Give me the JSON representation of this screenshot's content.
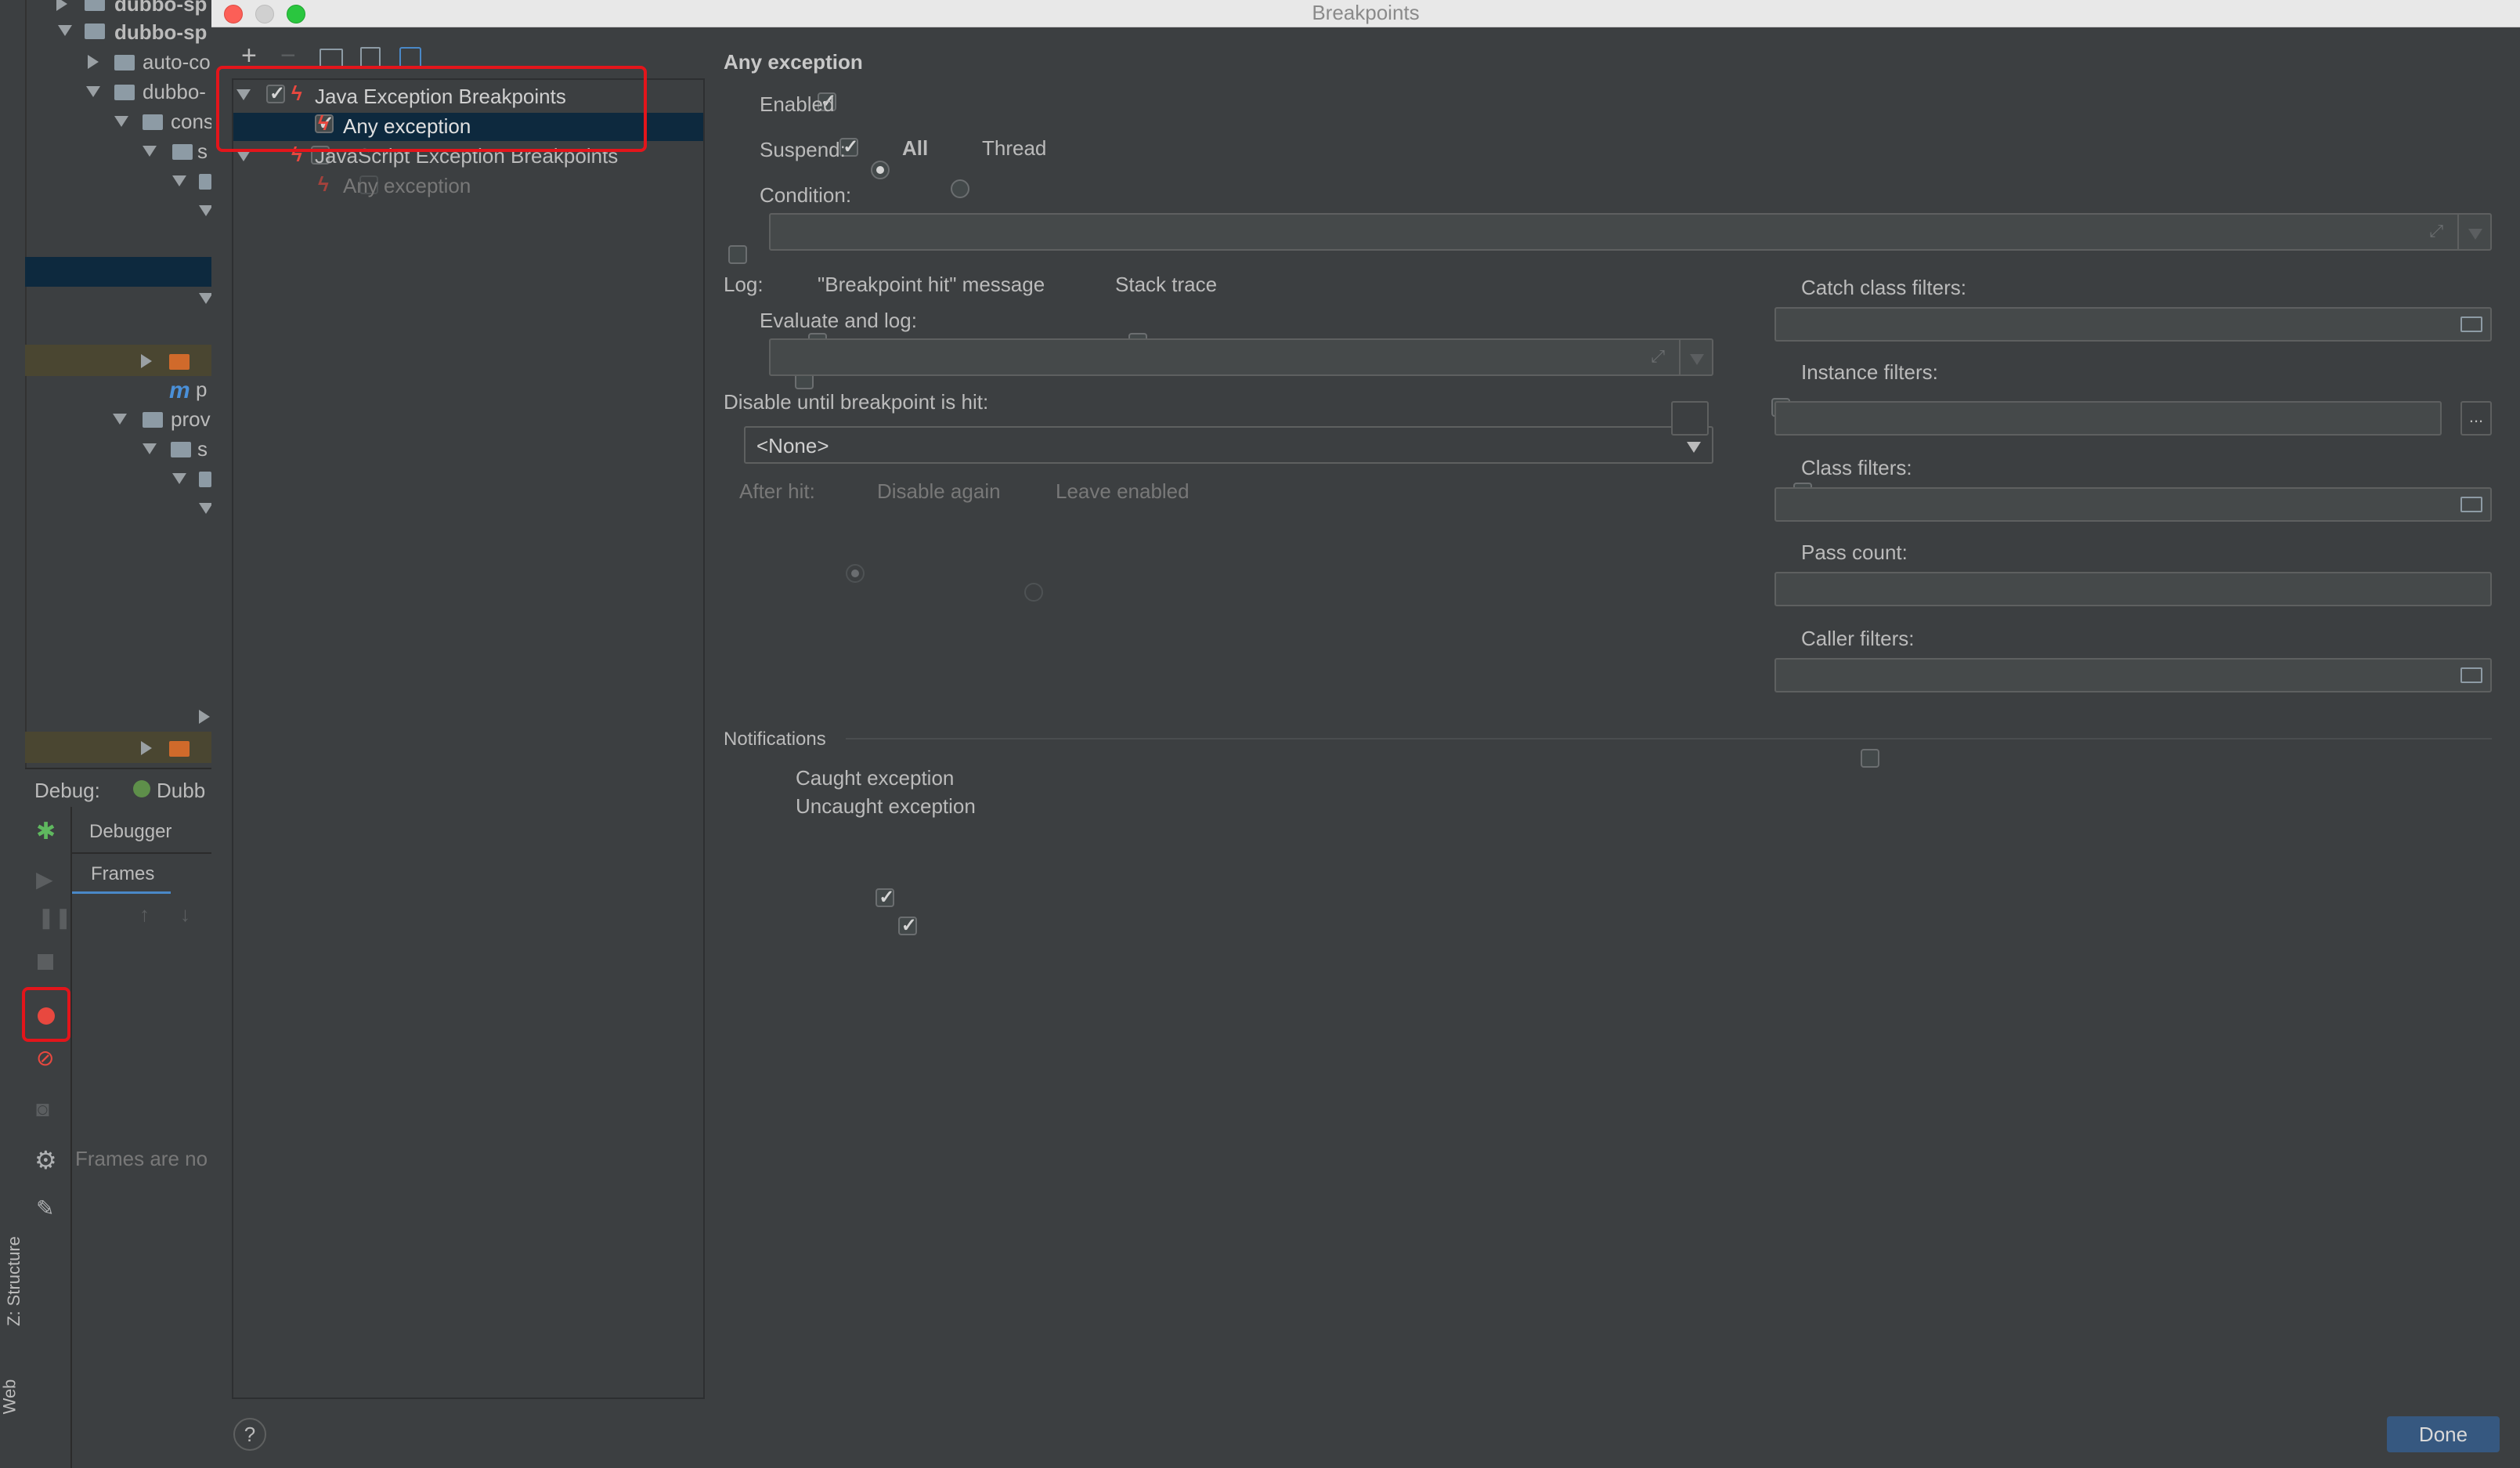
{
  "dialog": {
    "title": "Breakpoints",
    "done_label": "Done",
    "help_label": "?"
  },
  "tree": {
    "groups": [
      {
        "label": "Java Exception Breakpoints",
        "checked": true,
        "children": [
          {
            "label": "Any exception",
            "checked": true,
            "selected": true
          }
        ]
      },
      {
        "label": "JavaScript Exception Breakpoints",
        "checked": false,
        "children": [
          {
            "label": "Any exception",
            "checked": false
          }
        ]
      }
    ]
  },
  "details": {
    "heading": "Any exception",
    "enabled_label": "Enabled",
    "suspend_label": "Suspend:",
    "suspend_all_label": "All",
    "suspend_thread_label": "Thread",
    "condition_label": "Condition:",
    "log_label": "Log:",
    "log_message_label": "\"Breakpoint hit\" message",
    "log_stack_label": "Stack trace",
    "evaluate_label": "Evaluate and log:",
    "disable_until_label": "Disable until breakpoint is hit:",
    "disable_until_value": "<None>",
    "after_hit_label": "After hit:",
    "disable_again_label": "Disable again",
    "leave_enabled_label": "Leave enabled",
    "catch_filters_label": "Catch class filters:",
    "instance_filters_label": "Instance filters:",
    "instance_filters_btn": "...",
    "class_filters_label": "Class filters:",
    "pass_count_label": "Pass count:",
    "caller_filters_label": "Caller filters:",
    "notifications_label": "Notifications",
    "caught_label": "Caught exception",
    "uncaught_label": "Uncaught exception"
  },
  "ide": {
    "project_items": [
      "dubbo-sp",
      "dubbo-sp",
      "auto-co",
      "dubbo-",
      "cons",
      "s",
      "prov",
      "s",
      "m p",
      "p"
    ],
    "debug_label": "Debug:",
    "debug_config": "Dubb",
    "debugger_tab": "Debugger",
    "frames_tab": "Frames",
    "frames_empty": "Frames are no",
    "structure_tab": "Z: Structure",
    "web_tab": "Web"
  },
  "colors": {
    "highlight_red": "#e3151b",
    "selection": "#0d293e",
    "accent_blue": "#365880"
  }
}
